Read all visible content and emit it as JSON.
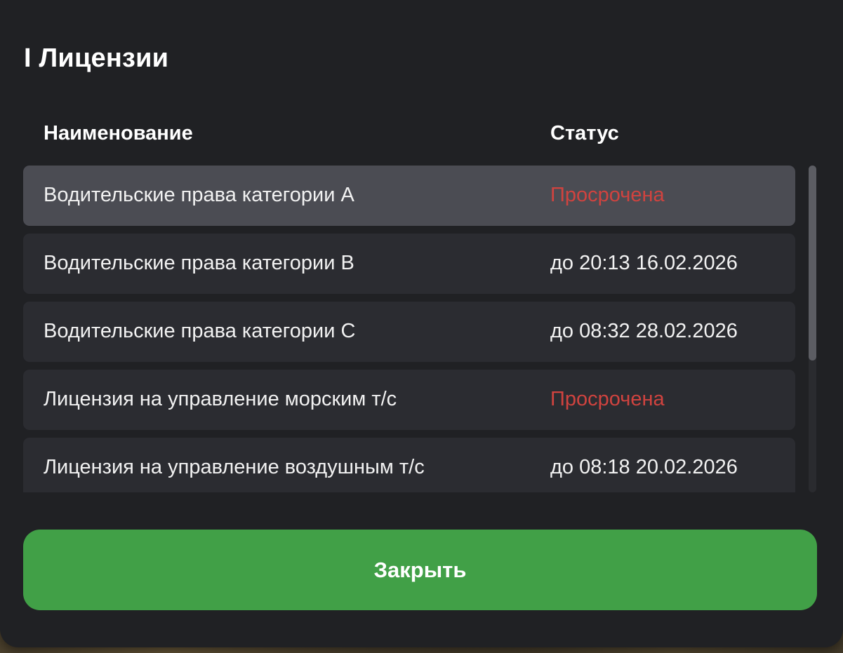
{
  "dialog": {
    "title": "I Лицензии",
    "columns": {
      "name": "Наименование",
      "status": "Статус"
    },
    "licenses": [
      {
        "name": "Водительские права категории A",
        "status": "Просрочена",
        "expired": true,
        "selected": true
      },
      {
        "name": "Водительские права категории B",
        "status": "до 20:13 16.02.2026",
        "expired": false,
        "selected": false
      },
      {
        "name": "Водительские права категории C",
        "status": "до 08:32 28.02.2026",
        "expired": false,
        "selected": false
      },
      {
        "name": "Лицензия на управление морским т/с",
        "status": "Просрочена",
        "expired": true,
        "selected": false
      },
      {
        "name": "Лицензия на управление воздушным т/с",
        "status": "до 08:18 20.02.2026",
        "expired": false,
        "selected": false
      }
    ],
    "close_label": "Закрыть"
  },
  "colors": {
    "panel": "#202124",
    "row": "#2b2c31",
    "row_selected": "#4b4c53",
    "expired": "#d0433f",
    "accent": "#41a047"
  }
}
